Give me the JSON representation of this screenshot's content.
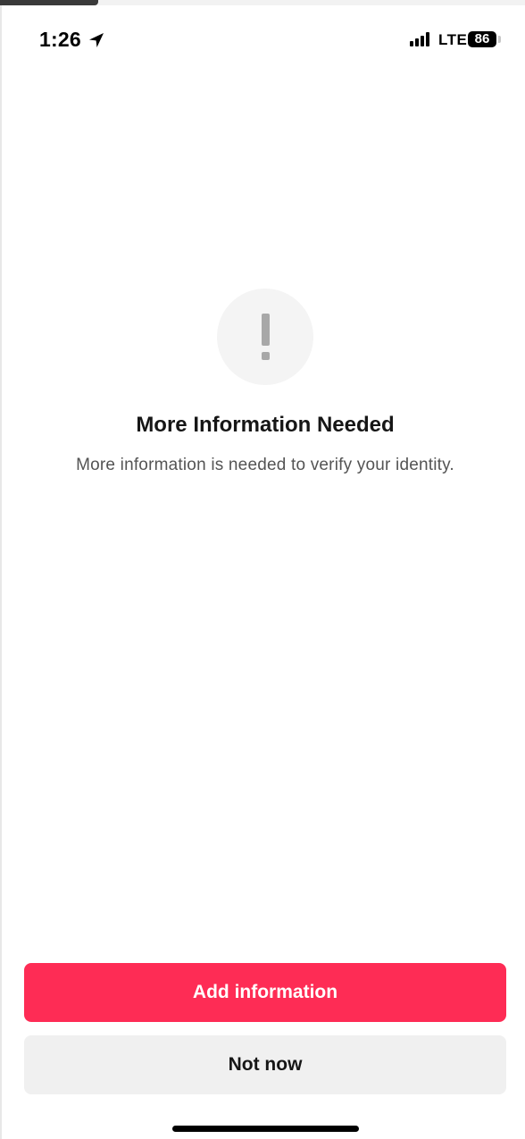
{
  "status_bar": {
    "time": "1:26",
    "network": "LTE",
    "battery": "86",
    "icons": [
      "location-arrow-icon",
      "signal-bars-icon",
      "battery-icon"
    ]
  },
  "alert": {
    "icon": "exclamation-icon",
    "title": "More Information Needed",
    "message": "More information is needed to verify your identity."
  },
  "actions": {
    "primary_label": "Add information",
    "secondary_label": "Not now"
  },
  "colors": {
    "accent": "#fe2c55",
    "secondary_button": "#f0f0f0",
    "icon_circle": "#f4f4f4",
    "icon": "#a8a8a8"
  }
}
